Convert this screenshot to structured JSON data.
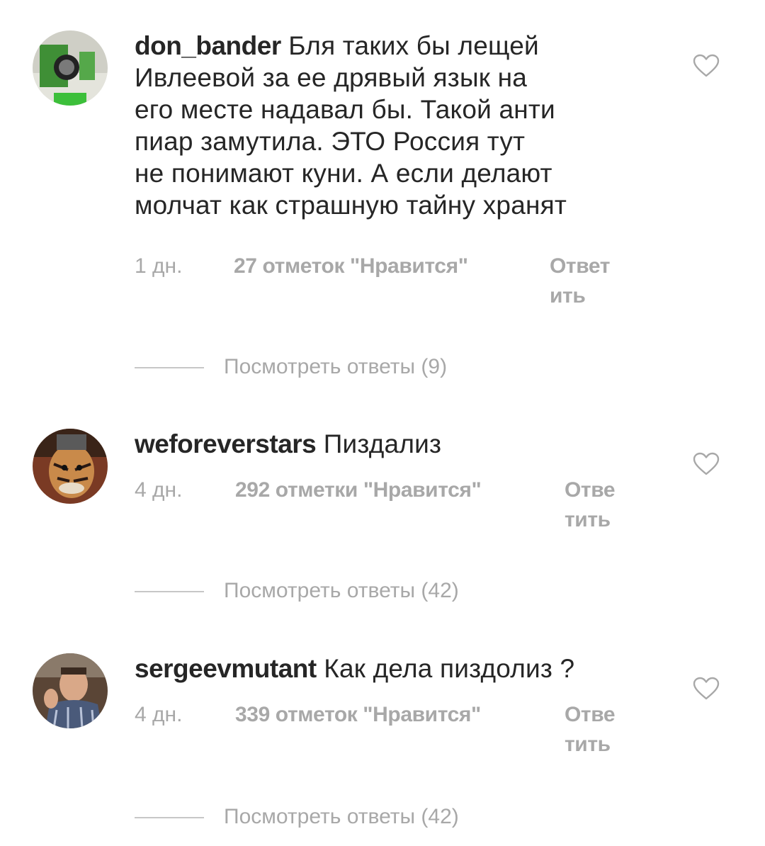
{
  "comments": [
    {
      "username": "don_bander",
      "text_lines": [
        "Бля таких бы лещей",
        "Ивлеевой за ее дрявый язык на",
        "его месте надавал бы. Такой анти",
        "пиар замутила. ЭТО Россия тут",
        "не понимают куни. А если делают",
        "молчат как страшную тайну хранят"
      ],
      "time": "1 дн.",
      "likes": "27 отметок \"Нравится\"",
      "reply_lines": [
        "Ответ",
        "ить"
      ],
      "view_replies": "Посмотреть ответы (9)",
      "avatar_colors": [
        "#5a9e4a",
        "#d8d8d0",
        "#2e6b2a"
      ]
    },
    {
      "username": "weforeverstars",
      "text_lines": [
        "Пиздализ"
      ],
      "time": "4 дн.",
      "likes": "292 отметки \"Нравится\"",
      "reply_lines": [
        "Отве",
        "тить"
      ],
      "view_replies": "Посмотреть ответы (42)",
      "avatar_colors": [
        "#8a4a2a",
        "#c98a4a",
        "#2a1a14"
      ]
    },
    {
      "username": "sergeevmutant",
      "text_lines": [
        "Как дела пиздолиз ?"
      ],
      "time": "4 дн.",
      "likes": "339 отметок \"Нравится\"",
      "reply_lines": [
        "Отве",
        "тить"
      ],
      "view_replies": "Посмотреть ответы (42)",
      "avatar_colors": [
        "#6a5040",
        "#d9a888",
        "#4a5a7a"
      ]
    }
  ],
  "icons": {
    "like": "heart-outline-icon"
  },
  "colors": {
    "text": "#262626",
    "secondary": "#a8a8a8",
    "divider": "#c7c7c7",
    "heart_stroke": "#a8a8a8"
  }
}
